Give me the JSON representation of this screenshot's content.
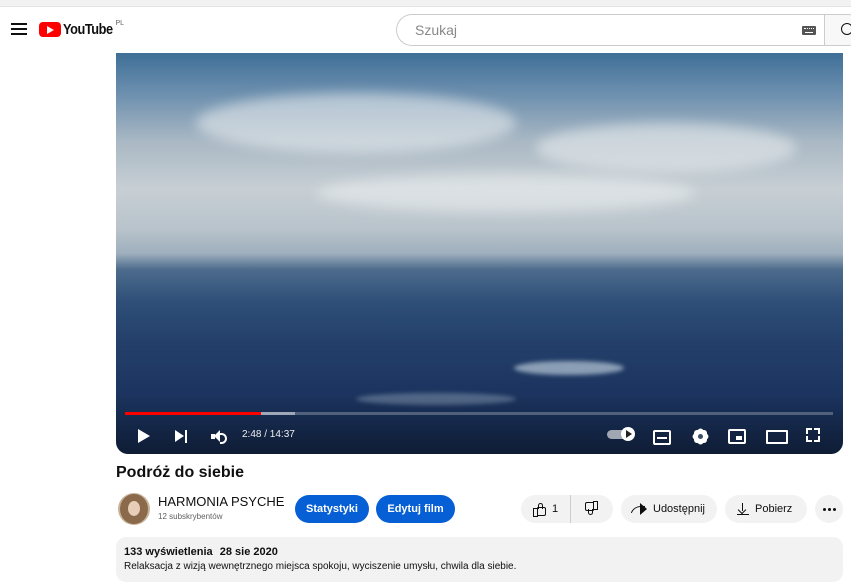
{
  "header": {
    "logo_text": "YouTube",
    "country_code": "PL",
    "search_placeholder": "Szukaj"
  },
  "player": {
    "time": "2:48 / 14:37",
    "progress_played": 0.192,
    "progress_buffered": 0.24
  },
  "video": {
    "title": "Podróż do siebie",
    "channel_name": "HARMONIA PSYCHE",
    "subscribers": "12 subskrybentów",
    "stats_button": "Statystyki",
    "edit_button": "Edytuj film",
    "like_count": "1",
    "share_label": "Udostępnij",
    "download_label": "Pobierz"
  },
  "description": {
    "views": "133 wyświetlenia",
    "date": "28 sie 2020",
    "text": "Relaksacja z wizją wewnętrznego miejsca spokoju, wyciszenie umysłu, chwila dla siebie."
  },
  "colors": {
    "brand": "#ff0000",
    "primary_button": "#065fd4",
    "progress": "#ff0000"
  }
}
